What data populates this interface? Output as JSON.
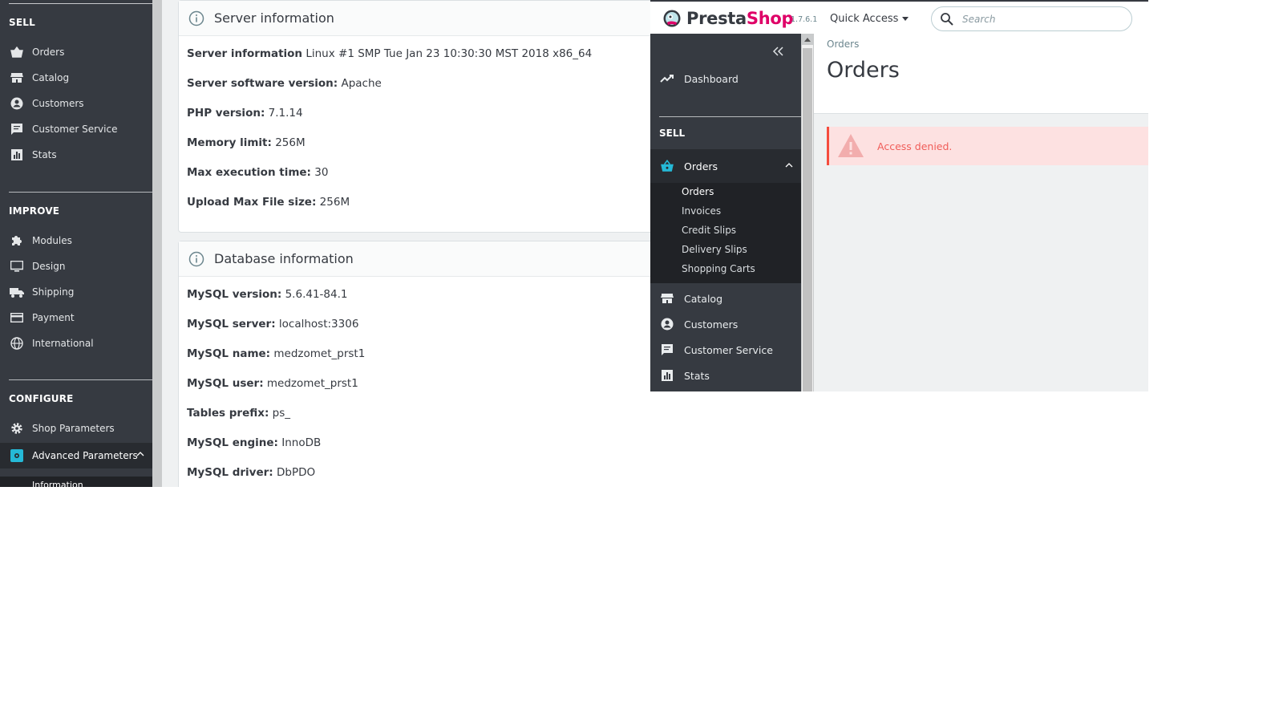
{
  "left": {
    "sidebar": {
      "sections": [
        "SELL",
        "IMPROVE",
        "CONFIGURE"
      ],
      "sell_items": [
        "Orders",
        "Catalog",
        "Customers",
        "Customer Service",
        "Stats"
      ],
      "improve_items": [
        "Modules",
        "Design",
        "Shipping",
        "Payment",
        "International"
      ],
      "configure_items": [
        "Shop Parameters",
        "Advanced Parameters"
      ],
      "sub_active": "Information"
    },
    "server_card": {
      "title": "Server information",
      "rows": [
        {
          "label": "Server information",
          "value": "Linux #1 SMP Tue Jan 23 10:30:30 MST 2018 x86_64"
        },
        {
          "label": "Server software version:",
          "value": "Apache"
        },
        {
          "label": "PHP version:",
          "value": "7.1.14"
        },
        {
          "label": "Memory limit:",
          "value": "256M"
        },
        {
          "label": "Max execution time:",
          "value": "30"
        },
        {
          "label": "Upload Max File size:",
          "value": "256M"
        }
      ]
    },
    "db_card": {
      "title": "Database information",
      "rows": [
        {
          "label": "MySQL version:",
          "value": "5.6.41-84.1"
        },
        {
          "label": "MySQL server:",
          "value": "localhost:3306"
        },
        {
          "label": "MySQL name:",
          "value": "medzomet_prst1"
        },
        {
          "label": "MySQL user:",
          "value": "medzomet_prst1"
        },
        {
          "label": "Tables prefix:",
          "value": "ps_"
        },
        {
          "label": "MySQL engine:",
          "value": "InnoDB"
        },
        {
          "label": "MySQL driver:",
          "value": "DbPDO"
        }
      ]
    }
  },
  "right": {
    "header": {
      "brand_presta": "Presta",
      "brand_shop": "Shop",
      "version": "1.7.6.1",
      "quick_access": "Quick Access",
      "search_placeholder": "Search"
    },
    "sidebar": {
      "dashboard": "Dashboard",
      "section": "SELL",
      "orders": "Orders",
      "sub_items": [
        "Orders",
        "Invoices",
        "Credit Slips",
        "Delivery Slips",
        "Shopping Carts"
      ],
      "items_after": [
        "Catalog",
        "Customers",
        "Customer Service",
        "Stats"
      ]
    },
    "content": {
      "breadcrumb": "Orders",
      "title": "Orders",
      "alert": "Access denied."
    }
  },
  "colors": {
    "sidebar_bg": "#363a41",
    "sidebar_active_bg": "#282b30",
    "accent": "#25b9d7",
    "brand_pink": "#df0067",
    "alert_bg": "#fde1e1",
    "alert_text": "#f05d59"
  }
}
